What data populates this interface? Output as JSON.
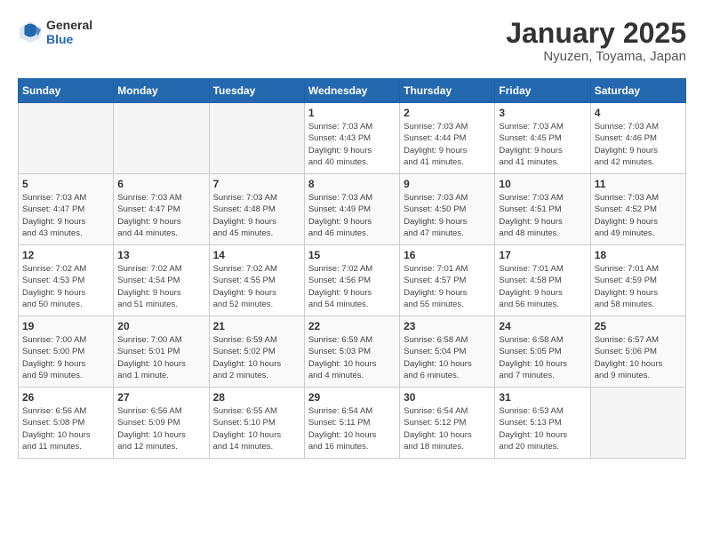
{
  "logo": {
    "general": "General",
    "blue": "Blue"
  },
  "title": "January 2025",
  "subtitle": "Nyuzen, Toyama, Japan",
  "weekdays": [
    "Sunday",
    "Monday",
    "Tuesday",
    "Wednesday",
    "Thursday",
    "Friday",
    "Saturday"
  ],
  "weeks": [
    [
      {
        "day": "",
        "info": ""
      },
      {
        "day": "",
        "info": ""
      },
      {
        "day": "",
        "info": ""
      },
      {
        "day": "1",
        "info": "Sunrise: 7:03 AM\nSunset: 4:43 PM\nDaylight: 9 hours\nand 40 minutes."
      },
      {
        "day": "2",
        "info": "Sunrise: 7:03 AM\nSunset: 4:44 PM\nDaylight: 9 hours\nand 41 minutes."
      },
      {
        "day": "3",
        "info": "Sunrise: 7:03 AM\nSunset: 4:45 PM\nDaylight: 9 hours\nand 41 minutes."
      },
      {
        "day": "4",
        "info": "Sunrise: 7:03 AM\nSunset: 4:46 PM\nDaylight: 9 hours\nand 42 minutes."
      }
    ],
    [
      {
        "day": "5",
        "info": "Sunrise: 7:03 AM\nSunset: 4:47 PM\nDaylight: 9 hours\nand 43 minutes."
      },
      {
        "day": "6",
        "info": "Sunrise: 7:03 AM\nSunset: 4:47 PM\nDaylight: 9 hours\nand 44 minutes."
      },
      {
        "day": "7",
        "info": "Sunrise: 7:03 AM\nSunset: 4:48 PM\nDaylight: 9 hours\nand 45 minutes."
      },
      {
        "day": "8",
        "info": "Sunrise: 7:03 AM\nSunset: 4:49 PM\nDaylight: 9 hours\nand 46 minutes."
      },
      {
        "day": "9",
        "info": "Sunrise: 7:03 AM\nSunset: 4:50 PM\nDaylight: 9 hours\nand 47 minutes."
      },
      {
        "day": "10",
        "info": "Sunrise: 7:03 AM\nSunset: 4:51 PM\nDaylight: 9 hours\nand 48 minutes."
      },
      {
        "day": "11",
        "info": "Sunrise: 7:03 AM\nSunset: 4:52 PM\nDaylight: 9 hours\nand 49 minutes."
      }
    ],
    [
      {
        "day": "12",
        "info": "Sunrise: 7:02 AM\nSunset: 4:53 PM\nDaylight: 9 hours\nand 50 minutes."
      },
      {
        "day": "13",
        "info": "Sunrise: 7:02 AM\nSunset: 4:54 PM\nDaylight: 9 hours\nand 51 minutes."
      },
      {
        "day": "14",
        "info": "Sunrise: 7:02 AM\nSunset: 4:55 PM\nDaylight: 9 hours\nand 52 minutes."
      },
      {
        "day": "15",
        "info": "Sunrise: 7:02 AM\nSunset: 4:56 PM\nDaylight: 9 hours\nand 54 minutes."
      },
      {
        "day": "16",
        "info": "Sunrise: 7:01 AM\nSunset: 4:57 PM\nDaylight: 9 hours\nand 55 minutes."
      },
      {
        "day": "17",
        "info": "Sunrise: 7:01 AM\nSunset: 4:58 PM\nDaylight: 9 hours\nand 56 minutes."
      },
      {
        "day": "18",
        "info": "Sunrise: 7:01 AM\nSunset: 4:59 PM\nDaylight: 9 hours\nand 58 minutes."
      }
    ],
    [
      {
        "day": "19",
        "info": "Sunrise: 7:00 AM\nSunset: 5:00 PM\nDaylight: 9 hours\nand 59 minutes."
      },
      {
        "day": "20",
        "info": "Sunrise: 7:00 AM\nSunset: 5:01 PM\nDaylight: 10 hours\nand 1 minute."
      },
      {
        "day": "21",
        "info": "Sunrise: 6:59 AM\nSunset: 5:02 PM\nDaylight: 10 hours\nand 2 minutes."
      },
      {
        "day": "22",
        "info": "Sunrise: 6:59 AM\nSunset: 5:03 PM\nDaylight: 10 hours\nand 4 minutes."
      },
      {
        "day": "23",
        "info": "Sunrise: 6:58 AM\nSunset: 5:04 PM\nDaylight: 10 hours\nand 6 minutes."
      },
      {
        "day": "24",
        "info": "Sunrise: 6:58 AM\nSunset: 5:05 PM\nDaylight: 10 hours\nand 7 minutes."
      },
      {
        "day": "25",
        "info": "Sunrise: 6:57 AM\nSunset: 5:06 PM\nDaylight: 10 hours\nand 9 minutes."
      }
    ],
    [
      {
        "day": "26",
        "info": "Sunrise: 6:56 AM\nSunset: 5:08 PM\nDaylight: 10 hours\nand 11 minutes."
      },
      {
        "day": "27",
        "info": "Sunrise: 6:56 AM\nSunset: 5:09 PM\nDaylight: 10 hours\nand 12 minutes."
      },
      {
        "day": "28",
        "info": "Sunrise: 6:55 AM\nSunset: 5:10 PM\nDaylight: 10 hours\nand 14 minutes."
      },
      {
        "day": "29",
        "info": "Sunrise: 6:54 AM\nSunset: 5:11 PM\nDaylight: 10 hours\nand 16 minutes."
      },
      {
        "day": "30",
        "info": "Sunrise: 6:54 AM\nSunset: 5:12 PM\nDaylight: 10 hours\nand 18 minutes."
      },
      {
        "day": "31",
        "info": "Sunrise: 6:53 AM\nSunset: 5:13 PM\nDaylight: 10 hours\nand 20 minutes."
      },
      {
        "day": "",
        "info": ""
      }
    ]
  ]
}
